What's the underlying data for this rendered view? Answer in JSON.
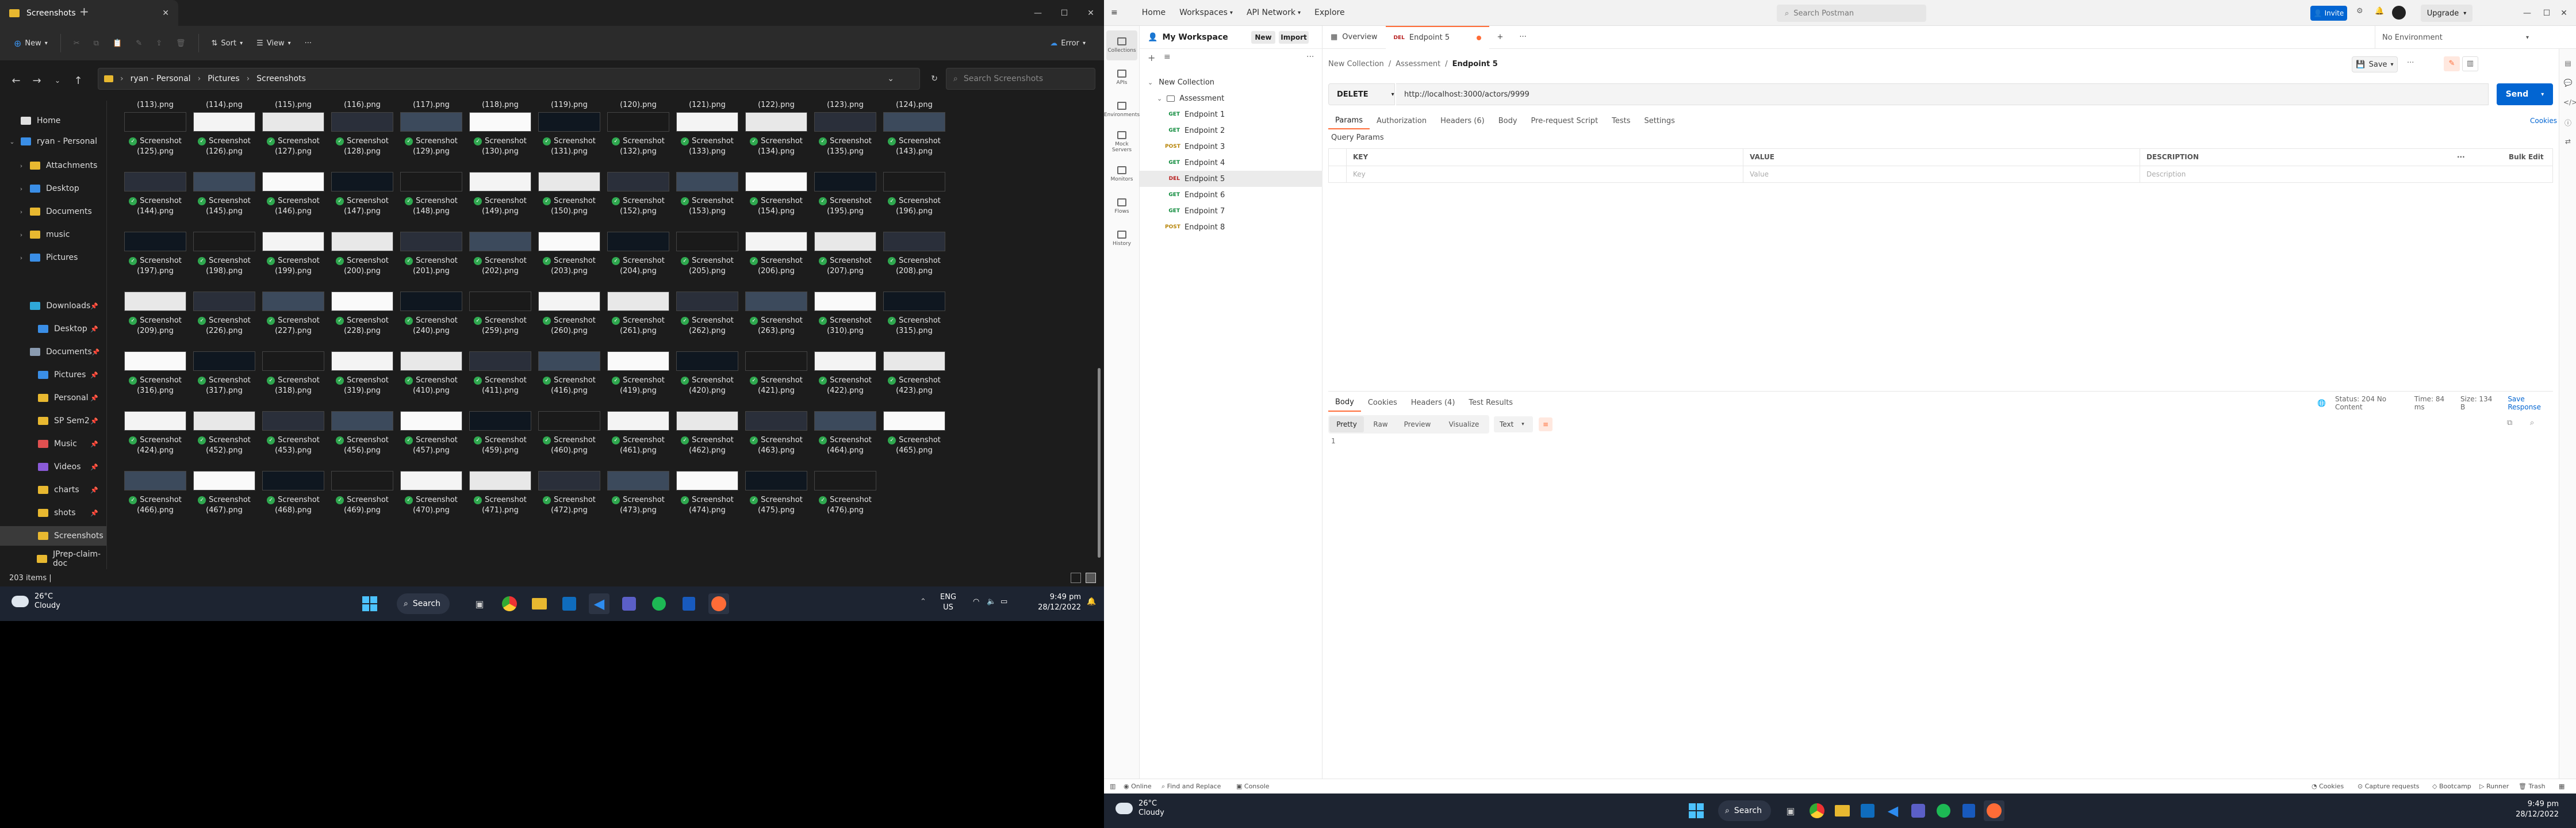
{
  "explorer": {
    "tab_title": "Screenshots",
    "cmd": {
      "new": "New",
      "sort": "Sort",
      "view": "View",
      "error": "Error"
    },
    "breadcrumb": [
      "ryan - Personal",
      "Pictures",
      "Screenshots"
    ],
    "search_placeholder": "Search Screenshots",
    "status": "203 items  |",
    "sidebar": [
      {
        "label": "Home",
        "color": "#e0e0e0",
        "pin": false,
        "chev": false,
        "indent": 14
      },
      {
        "label": "ryan - Personal",
        "color": "#3a8ee6",
        "pin": false,
        "chev": true,
        "indent": 14
      },
      {
        "label": "Attachments",
        "color": "#e8b830",
        "pin": false,
        "chev": true,
        "indent": 30
      },
      {
        "label": "Desktop",
        "color": "#3a8ee6",
        "pin": false,
        "chev": true,
        "indent": 30
      },
      {
        "label": "Documents",
        "color": "#e8b830",
        "pin": false,
        "chev": true,
        "indent": 30
      },
      {
        "label": "music",
        "color": "#e8b830",
        "pin": false,
        "chev": true,
        "indent": 30
      },
      {
        "label": "Pictures",
        "color": "#3a8ee6",
        "pin": false,
        "chev": true,
        "indent": 30
      },
      {
        "label": "Downloads",
        "color": "#2fa8d8",
        "pin": true,
        "chev": false,
        "indent": 44
      },
      {
        "label": "Desktop",
        "color": "#3a8ee6",
        "pin": true,
        "chev": false,
        "indent": 44
      },
      {
        "label": "Documents",
        "color": "#8a9bb0",
        "pin": true,
        "chev": false,
        "indent": 44
      },
      {
        "label": "Pictures",
        "color": "#3a8ee6",
        "pin": true,
        "chev": false,
        "indent": 44
      },
      {
        "label": "Personal",
        "color": "#e8b830",
        "pin": true,
        "chev": false,
        "indent": 44
      },
      {
        "label": "SP Sem2",
        "color": "#e8b830",
        "pin": true,
        "chev": false,
        "indent": 44
      },
      {
        "label": "Music",
        "color": "#e05050",
        "pin": true,
        "chev": false,
        "indent": 44
      },
      {
        "label": "Videos",
        "color": "#8a5ad8",
        "pin": true,
        "chev": false,
        "indent": 44
      },
      {
        "label": "charts",
        "color": "#e8b830",
        "pin": true,
        "chev": false,
        "indent": 44
      },
      {
        "label": "shots",
        "color": "#e8b830",
        "pin": true,
        "chev": false,
        "indent": 44
      },
      {
        "label": "Screenshots",
        "color": "#e8b830",
        "pin": false,
        "chev": false,
        "indent": 44
      },
      {
        "label": "JPrep-claim-doc",
        "color": "#e8b830",
        "pin": false,
        "chev": false,
        "indent": 44
      }
    ],
    "top_row": [
      "(113).png",
      "(114).png",
      "(115).png",
      "(116).png",
      "(117).png",
      "(118).png",
      "(119).png",
      "(120).png",
      "(121).png",
      "(122).png",
      "(123).png",
      "(124).png"
    ],
    "rows": [
      [
        "(125).png",
        "(126).png",
        "(127).png",
        "(128).png",
        "(129).png",
        "(130).png",
        "(131).png",
        "(132).png",
        "(133).png",
        "(134).png",
        "(135).png",
        "(143).png"
      ],
      [
        "(144).png",
        "(145).png",
        "(146).png",
        "(147).png",
        "(148).png",
        "(149).png",
        "(150).png",
        "(152).png",
        "(153).png",
        "(154).png",
        "(195).png",
        "(196).png"
      ],
      [
        "(197).png",
        "(198).png",
        "(199).png",
        "(200).png",
        "(201).png",
        "(202).png",
        "(203).png",
        "(204).png",
        "(205).png",
        "(206).png",
        "(207).png",
        "(208).png"
      ],
      [
        "(209).png",
        "(226).png",
        "(227).png",
        "(228).png",
        "(240).png",
        "(259).png",
        "(260).png",
        "(261).png",
        "(262).png",
        "(263).png",
        "(310).png",
        "(315).png"
      ],
      [
        "(316).png",
        "(317).png",
        "(318).png",
        "(319).png",
        "(410).png",
        "(411).png",
        "(416).png",
        "(419).png",
        "(420).png",
        "(421).png",
        "(422).png",
        "(423).png"
      ],
      [
        "(424).png",
        "(452).png",
        "(453).png",
        "(456).png",
        "(457).png",
        "(459).png",
        "(460).png",
        "(461).png",
        "(462).png",
        "(463).png",
        "(464).png",
        "(465).png"
      ],
      [
        "(466).png",
        "(467).png",
        "(468).png",
        "(469).png",
        "(470).png",
        "(471).png",
        "(472).png",
        "(473).png",
        "(474).png",
        "(475).png",
        "(476).png"
      ]
    ],
    "cell_prefix": "Screenshot"
  },
  "taskbar1": {
    "temp": "26°C",
    "cond": "Cloudy",
    "search": "Search",
    "lang1": "ENG",
    "lang2": "US",
    "time": "9:49 pm",
    "date": "28/12/2022"
  },
  "taskbar2": {
    "temp": "26°C",
    "cond": "Cloudy",
    "search": "Search",
    "time": "9:49 pm",
    "date": "28/12/2022"
  },
  "postman": {
    "menu": {
      "home": "Home",
      "workspaces": "Workspaces",
      "api_network": "API Network",
      "explore": "Explore"
    },
    "search_placeholder": "Search Postman",
    "invite": "Invite",
    "upgrade": "Upgrade",
    "workspace": "My Workspace",
    "new_btn": "New",
    "import_btn": "Import",
    "leftbar": [
      "Collections",
      "APIs",
      "Environments",
      "Mock Servers",
      "Monitors",
      "Flows",
      "History"
    ],
    "tree": {
      "collection": "New Collection",
      "folder": "Assessment",
      "items": [
        {
          "m": "GET",
          "label": "Endpoint 1"
        },
        {
          "m": "GET",
          "label": "Endpoint 2"
        },
        {
          "m": "POST",
          "label": "Endpoint 3"
        },
        {
          "m": "GET",
          "label": "Endpoint 4"
        },
        {
          "m": "DEL",
          "label": "Endpoint 5"
        },
        {
          "m": "GET",
          "label": "Endpoint 6"
        },
        {
          "m": "GET",
          "label": "Endpoint 7"
        },
        {
          "m": "POST",
          "label": "Endpoint 8"
        }
      ]
    },
    "tabs": {
      "overview": "Overview",
      "active_method": "DEL",
      "active": "Endpoint 5"
    },
    "environment": "No Environment",
    "crumb": [
      "New Collection",
      "Assessment",
      "Endpoint 5"
    ],
    "save": "Save",
    "method": "DELETE",
    "url": "http://localhost:3000/actors/9999",
    "send": "Send",
    "req_tabs": [
      "Params",
      "Authorization",
      "Headers (6)",
      "Body",
      "Pre-request Script",
      "Tests",
      "Settings"
    ],
    "cookies": "Cookies",
    "query_params": "Query Params",
    "table": {
      "key": "KEY",
      "value": "VALUE",
      "desc": "DESCRIPTION",
      "bulk": "Bulk Edit",
      "key_ph": "Key",
      "value_ph": "Value",
      "desc_ph": "Description"
    },
    "resp_tabs": [
      "Body",
      "Cookies",
      "Headers (4)",
      "Test Results"
    ],
    "resp_status": {
      "status": "Status: 204 No Content",
      "time": "Time: 84 ms",
      "size": "Size: 134 B",
      "save": "Save Response"
    },
    "resp_view": [
      "Pretty",
      "Raw",
      "Preview",
      "Visualize"
    ],
    "resp_format": "Text",
    "body_line": "1",
    "footer": {
      "online": "Online",
      "find": "Find and Replace",
      "console": "Console",
      "cookies": "Cookies",
      "capture": "Capture requests",
      "bootcamp": "Bootcamp",
      "runner": "Runner",
      "trash": "Trash"
    }
  }
}
